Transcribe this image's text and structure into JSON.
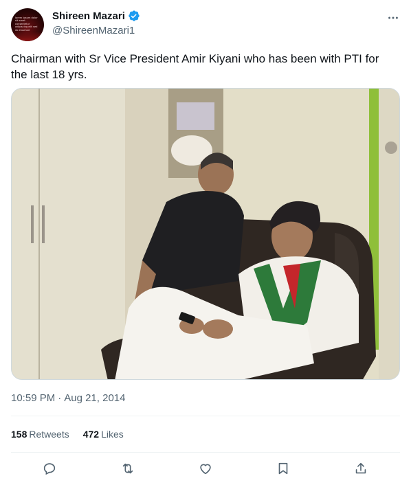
{
  "author": {
    "display_name": "Shireen Mazari",
    "handle": "@ShireenMazari1",
    "verified": true,
    "avatar_text": "lorem ipsum dolor sit amet consectetur adipiscing elit sed do eiusmod"
  },
  "tweet": {
    "text": "Chairman with Sr Vice President Amir Kiyani who has been with PTI for the last 18 yrs.",
    "time": "10:59 PM",
    "date": "Aug 21, 2014",
    "separator": "·"
  },
  "stats": {
    "retweets_count": "158",
    "retweets_label": "Retweets",
    "likes_count": "472",
    "likes_label": "Likes"
  },
  "icons": {
    "verified": "verified-badge-icon",
    "more": "more-options-icon",
    "reply": "reply-icon",
    "retweet": "retweet-icon",
    "like": "heart-icon",
    "bookmark": "bookmark-icon",
    "share": "share-icon"
  },
  "colors": {
    "text": "#0f1419",
    "secondary": "#536471",
    "verified_blue": "#1d9bf0",
    "divider": "#eff3f4"
  }
}
